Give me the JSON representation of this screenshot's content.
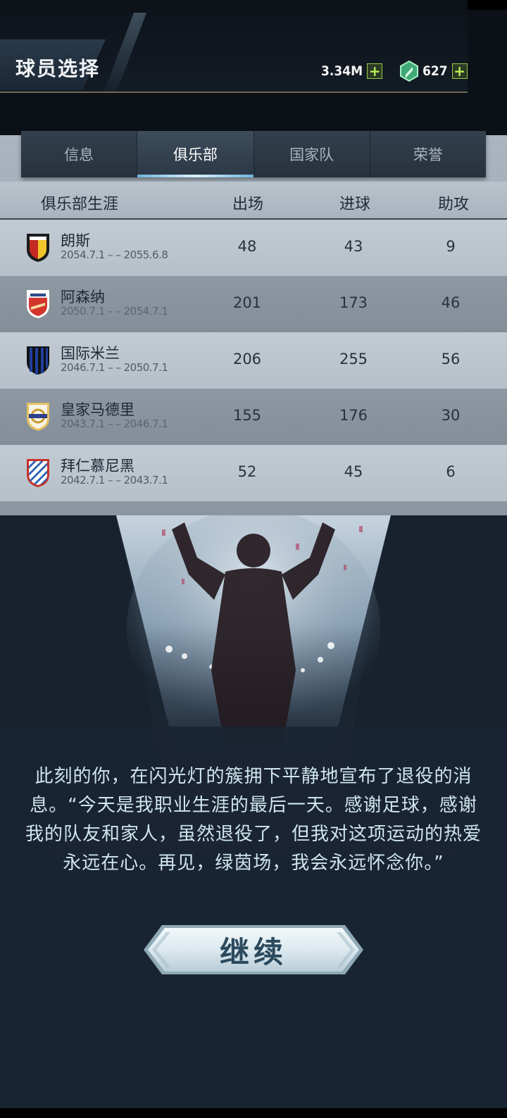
{
  "header": {
    "title": "球员选择",
    "coins": "3.34M",
    "gems": "627"
  },
  "tabs": [
    {
      "label": "信息",
      "active": false
    },
    {
      "label": "俱乐部",
      "active": true
    },
    {
      "label": "国家队",
      "active": false
    },
    {
      "label": "荣誉",
      "active": false
    }
  ],
  "table": {
    "headers": {
      "club": "俱乐部生涯",
      "appearances": "出场",
      "goals": "进球",
      "assists": "助攻"
    },
    "rows": [
      {
        "club": "朗斯",
        "dates": "2054.7.1 – – 2055.6.8",
        "appearances": "48",
        "goals": "43",
        "assists": "9",
        "badge": "lens-badge-icon"
      },
      {
        "club": "阿森纳",
        "dates": "2050.7.1 – – 2054.7.1",
        "appearances": "201",
        "goals": "173",
        "assists": "46",
        "badge": "arsenal-badge-icon"
      },
      {
        "club": "国际米兰",
        "dates": "2046.7.1 – – 2050.7.1",
        "appearances": "206",
        "goals": "255",
        "assists": "56",
        "badge": "inter-badge-icon"
      },
      {
        "club": "皇家马德里",
        "dates": "2043.7.1 – – 2046.7.1",
        "appearances": "155",
        "goals": "176",
        "assists": "30",
        "badge": "real-madrid-badge-icon"
      },
      {
        "club": "拜仁慕尼黑",
        "dates": "2042.7.1 – – 2043.7.1",
        "appearances": "52",
        "goals": "45",
        "assists": "6",
        "badge": "bayern-badge-icon"
      }
    ]
  },
  "story": "此刻的你，在闪光灯的簇拥下平静地宣布了退役的消息。“今天是我职业生涯的最后一天。感谢足球，感谢我的队友和家人，虽然退役了，但我对这项运动的热爱永远在心。再见，绿茵场，我会永远怀念你。”",
  "continue_label": "继续",
  "colors": {
    "accent_green": "#98c94b",
    "story_text": "#cfe6ee",
    "tab_active_underline": "#6fb3dc"
  }
}
